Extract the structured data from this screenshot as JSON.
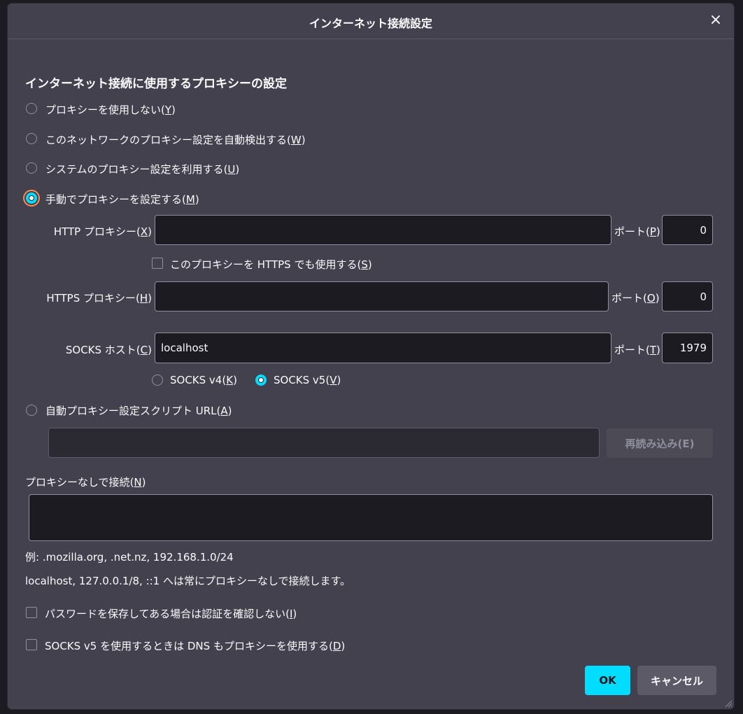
{
  "dialog": {
    "title": "インターネット接続設定",
    "close_icon": "×"
  },
  "section_heading": "インターネット接続に使用するプロキシーの設定",
  "proxy_modes": [
    {
      "label": "プロキシーを使用しない",
      "key": "Y",
      "checked": false
    },
    {
      "label": "このネットワークのプロキシー設定を自動検出する",
      "key": "W",
      "checked": false
    },
    {
      "label": "システムのプロキシー設定を利用する",
      "key": "U",
      "checked": false
    },
    {
      "label": "手動でプロキシーを設定する",
      "key": "M",
      "checked": true
    }
  ],
  "http": {
    "label": "HTTP プロキシー",
    "key": "X",
    "value": "",
    "port_label": "ポート",
    "port_key": "P",
    "port": "0"
  },
  "also_https": {
    "label": "このプロキシーを HTTPS でも使用する",
    "key": "S",
    "checked": false
  },
  "https": {
    "label": "HTTPS プロキシー",
    "key": "H",
    "value": "",
    "port_label": "ポート",
    "port_key": "O",
    "port": "0"
  },
  "socks": {
    "label": "SOCKS ホスト",
    "key": "C",
    "value": "localhost",
    "port_label": "ポート",
    "port_key": "T",
    "port": "1979"
  },
  "socks_versions": [
    {
      "label": "SOCKS v4",
      "key": "K",
      "checked": false
    },
    {
      "label": "SOCKS v5",
      "key": "V",
      "checked": true
    }
  ],
  "auto_url": {
    "label": "自動プロキシー設定スクリプト URL",
    "key": "A",
    "value": "",
    "reload_label": "再読み込み(E)"
  },
  "no_proxy": {
    "label": "プロキシーなしで接続",
    "key": "N",
    "value": ""
  },
  "example_text": "例: .mozilla.org, .net.nz, 192.168.1.0/24",
  "localhost_note": "localhost, 127.0.0.1/8, ::1 へは常にプロキシーなしで接続します。",
  "options": [
    {
      "label": "パスワードを保存してある場合は認証を確認しない",
      "key": "I",
      "checked": false
    },
    {
      "label": "SOCKS v5 を使用するときは DNS もプロキシーを使用する",
      "key": "D",
      "checked": false
    }
  ],
  "buttons": {
    "ok": "OK",
    "cancel": "キャンセル"
  },
  "colors": {
    "accent": "#00ddff",
    "background": "#42414d",
    "field": "#1c1b22",
    "focus_ring": "#ff8a50"
  }
}
